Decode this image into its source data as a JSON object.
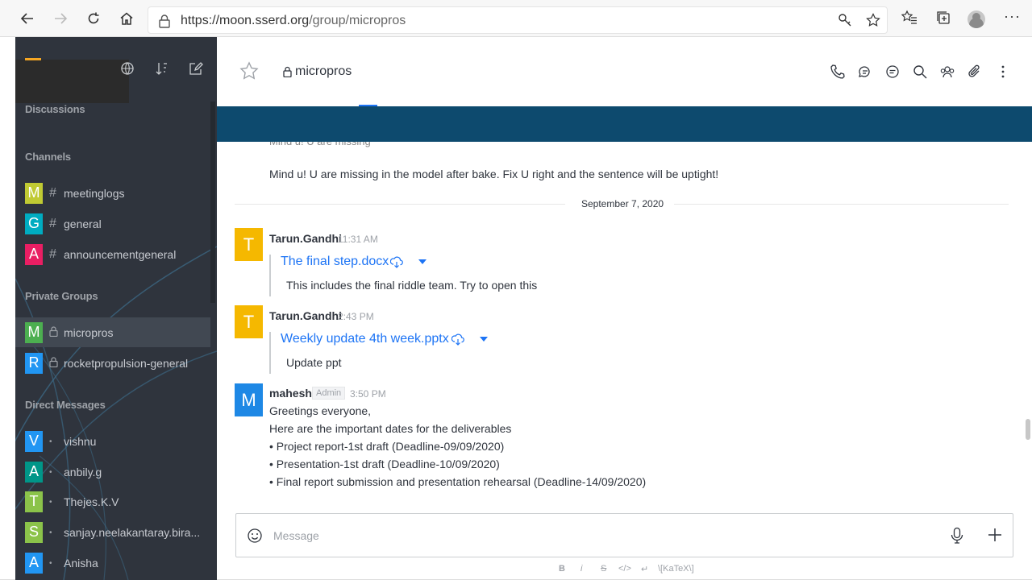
{
  "browser": {
    "url_host": "https://moon.sserd.org",
    "url_path": "/group/micropros"
  },
  "sidebar": {
    "sections": {
      "discussions": "Discussions",
      "channels": "Channels",
      "private_groups": "Private Groups",
      "direct_messages": "Direct Messages"
    },
    "channels": [
      {
        "initial": "M",
        "color": "#c0ca33",
        "name": "meetinglogs"
      },
      {
        "initial": "G",
        "color": "#00acc1",
        "name": "general"
      },
      {
        "initial": "A",
        "color": "#e91e63",
        "name": "announcementgeneral"
      }
    ],
    "private_groups": [
      {
        "initial": "M",
        "color": "#4caf50",
        "name": "micropros"
      },
      {
        "initial": "R",
        "color": "#2196f3",
        "name": "rocketpropulsion-general"
      }
    ],
    "direct_messages": [
      {
        "initial": "V",
        "color": "#2196f3",
        "name": "vishnu"
      },
      {
        "initial": "A",
        "color": "#009688",
        "name": "anbily.g"
      },
      {
        "initial": "T",
        "color": "#8bc34a",
        "name": "Thejes.K.V"
      },
      {
        "initial": "S",
        "color": "#8bc34a",
        "name": "sanjay.neelakantaray.bira..."
      },
      {
        "initial": "A",
        "color": "#2196f3",
        "name": "Anisha"
      }
    ]
  },
  "room": {
    "name": "micropros"
  },
  "messages": {
    "prev_text": "Mind u! U are missing in the model after bake. Fix U right and the sentence will be uptight!",
    "date_divider": "September 7, 2020",
    "items": [
      {
        "initial": "T",
        "color": "#f5b800",
        "user": "Tarun.Gandhi",
        "time": "11:31 AM",
        "file": "The final step.docx",
        "desc": "This includes the final riddle team. Try to open this"
      },
      {
        "initial": "T",
        "color": "#f5b800",
        "user": "Tarun.Gandhi",
        "time": "2:43 PM",
        "file": "Weekly update 4th week.pptx",
        "desc": "Update ppt"
      }
    ],
    "admin_msg": {
      "initial": "M",
      "color": "#1e88e5",
      "user": "mahesh",
      "role": "Admin",
      "time": "3:50 PM",
      "lines": [
        "Greetings everyone,",
        "Here are the important dates for the deliverables",
        "• Project report-1st draft (Deadline-09/09/2020)",
        "• Presentation-1st draft (Deadline-10/09/2020)",
        "• Final report submission and presentation rehearsal (Deadline-14/09/2020)"
      ]
    }
  },
  "composer": {
    "placeholder": "Message",
    "format_bold": "B",
    "format_italic": "i",
    "format_strike": "S",
    "format_code": "</>",
    "format_multiline": "↵",
    "format_katex": "\\[KaTeX\\]"
  }
}
